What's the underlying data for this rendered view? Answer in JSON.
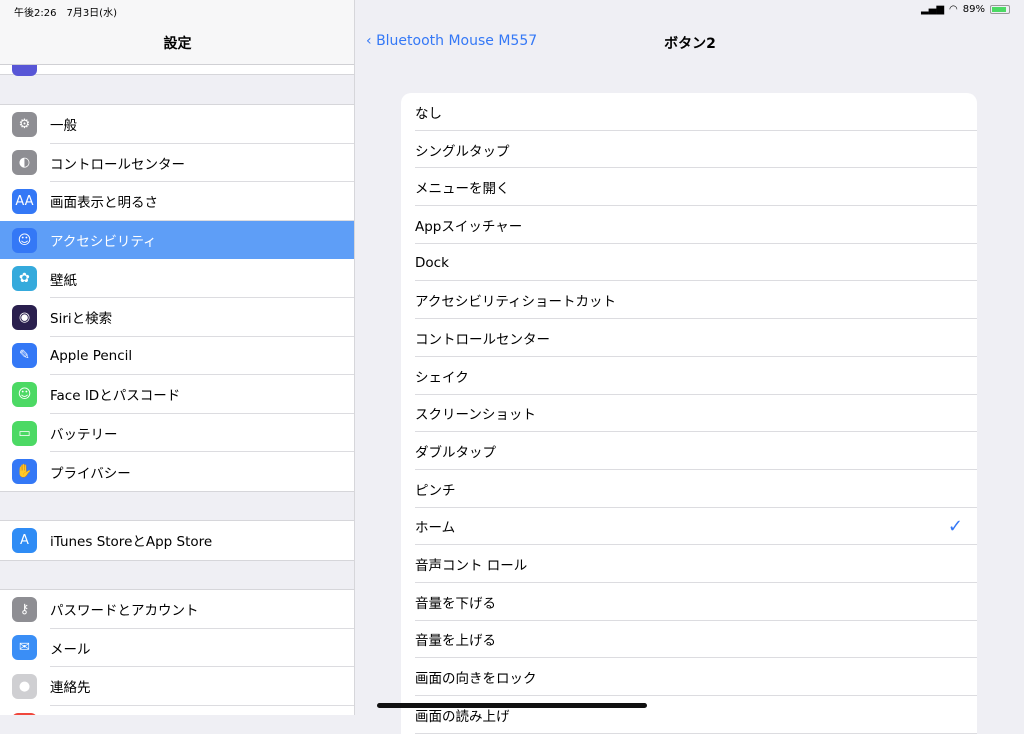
{
  "status": {
    "time": "午後2:26　7月3日(水)",
    "battery": "89%"
  },
  "sidebar": {
    "title": "設定",
    "group1": [
      {
        "label": "一般",
        "icon": "gear-icon",
        "color": "#8e8e93",
        "glyph": "⚙"
      },
      {
        "label": "コントロールセンター",
        "icon": "toggle-icon",
        "color": "#8e8e93",
        "glyph": "◐"
      },
      {
        "label": "画面表示と明るさ",
        "icon": "display-icon",
        "color": "#3478f6",
        "glyph": "AA"
      },
      {
        "label": "アクセシビリティ",
        "icon": "accessibility-icon",
        "color": "#3478f6",
        "glyph": "☺"
      },
      {
        "label": "壁紙",
        "icon": "wallpaper-icon",
        "color": "#35aadc",
        "glyph": "✿"
      },
      {
        "label": "Siriと検索",
        "icon": "siri-icon",
        "color": "#2a1f4e",
        "glyph": "◉"
      },
      {
        "label": "Apple Pencil",
        "icon": "pencil-icon",
        "color": "#3478f6",
        "glyph": "✎"
      },
      {
        "label": "Face IDとパスコード",
        "icon": "faceid-icon",
        "color": "#4cd964",
        "glyph": "☺"
      },
      {
        "label": "バッテリー",
        "icon": "battery-icon",
        "color": "#4cd964",
        "glyph": "▭"
      },
      {
        "label": "プライバシー",
        "icon": "hand-icon",
        "color": "#3478f6",
        "glyph": "✋"
      }
    ],
    "group2": [
      {
        "label": "iTunes StoreとApp Store",
        "icon": "appstore-icon",
        "color": "#2f8cf5",
        "glyph": "A"
      }
    ],
    "group3": [
      {
        "label": "パスワードとアカウント",
        "icon": "key-icon",
        "color": "#8e8e93",
        "glyph": "⚷"
      },
      {
        "label": "メール",
        "icon": "mail-icon",
        "color": "#3a8ef6",
        "glyph": "✉"
      },
      {
        "label": "連絡先",
        "icon": "contacts-icon",
        "color": "#cfcfd2",
        "glyph": "●"
      },
      {
        "label": "",
        "icon": "calendar-icon",
        "color": "#f0473c",
        "glyph": ""
      }
    ]
  },
  "detail": {
    "back": "Bluetooth Mouse M557",
    "title": "ボタン2",
    "selected": "ホーム",
    "options": [
      "なし",
      "シングルタップ",
      "メニューを開く",
      "Appスイッチャー",
      "Dock",
      "アクセシビリティショートカット",
      "コントロールセンター",
      "シェイク",
      "スクリーンショット",
      "ダブルタップ",
      "ピンチ",
      "ホーム",
      "音声コント ロール",
      "音量を下げる",
      "音量を上げる",
      "画面の向きをロック",
      "画面の読み上げ"
    ]
  }
}
